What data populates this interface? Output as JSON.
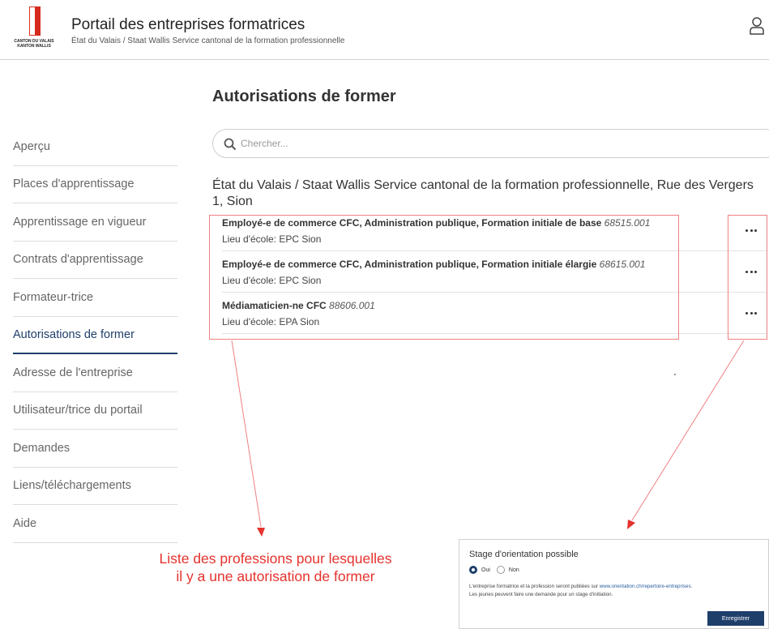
{
  "header": {
    "logo_line1": "CANTON DU VALAIS",
    "logo_line2": "KANTON WALLIS",
    "title": "Portail des entreprises formatrices",
    "subtitle": "État du Valais / Staat Wallis Service cantonal de la formation professionnelle",
    "user_icon": "user-icon"
  },
  "sidebar": {
    "items": [
      {
        "label": "Aperçu"
      },
      {
        "label": "Places d'apprentissage"
      },
      {
        "label": "Apprentissage en vigueur"
      },
      {
        "label": "Contrats d'apprentissage"
      },
      {
        "label": "Formateur-trice"
      },
      {
        "label": "Autorisations de former"
      },
      {
        "label": "Adresse de l'entreprise"
      },
      {
        "label": "Utilisateur/trice du portail"
      },
      {
        "label": "Demandes"
      },
      {
        "label": "Liens/téléchargements"
      },
      {
        "label": "Aide"
      }
    ],
    "active_index": 5
  },
  "main": {
    "title": "Autorisations de former",
    "search": {
      "placeholder": "Chercher...",
      "value": ""
    },
    "org_heading": "État du Valais / Staat Wallis Service cantonal de la formation professionnelle, Rue des Vergers 1, Sion",
    "authorizations": [
      {
        "title": "Employé-e de commerce CFC, Administration publique, Formation initiale de base",
        "code": "68515.001",
        "school": "Lieu d'école: EPC Sion"
      },
      {
        "title": "Employé-e de commerce CFC, Administration publique, Formation initiale élargie",
        "code": "68615.001",
        "school": "Lieu d'école: EPC Sion"
      },
      {
        "title": "Médiamaticien-ne CFC",
        "code": "88606.001",
        "school": "Lieu d'école: EPA Sion"
      }
    ]
  },
  "annotation": {
    "line1": "Liste des professions pour lesquelles",
    "line2": "il y a une autorisation de former",
    "color": "#e5322d"
  },
  "inset": {
    "title": "Stage d'orientation possible",
    "option_yes": "Oui",
    "option_no": "Non",
    "selected": "Oui",
    "desc_prefix": "L'entreprise formatrice et la profession seront publiées sur ",
    "desc_link": "www.orientation.ch/repertoire-entreprises",
    "desc_suffix": ".",
    "desc_line2": "Les jeunes peuvent faire une demande pour un stage d'initiation.",
    "save_label": "Enregistrer"
  },
  "colors": {
    "accent": "#1f3f6b",
    "brand_red": "#d52b1e"
  }
}
